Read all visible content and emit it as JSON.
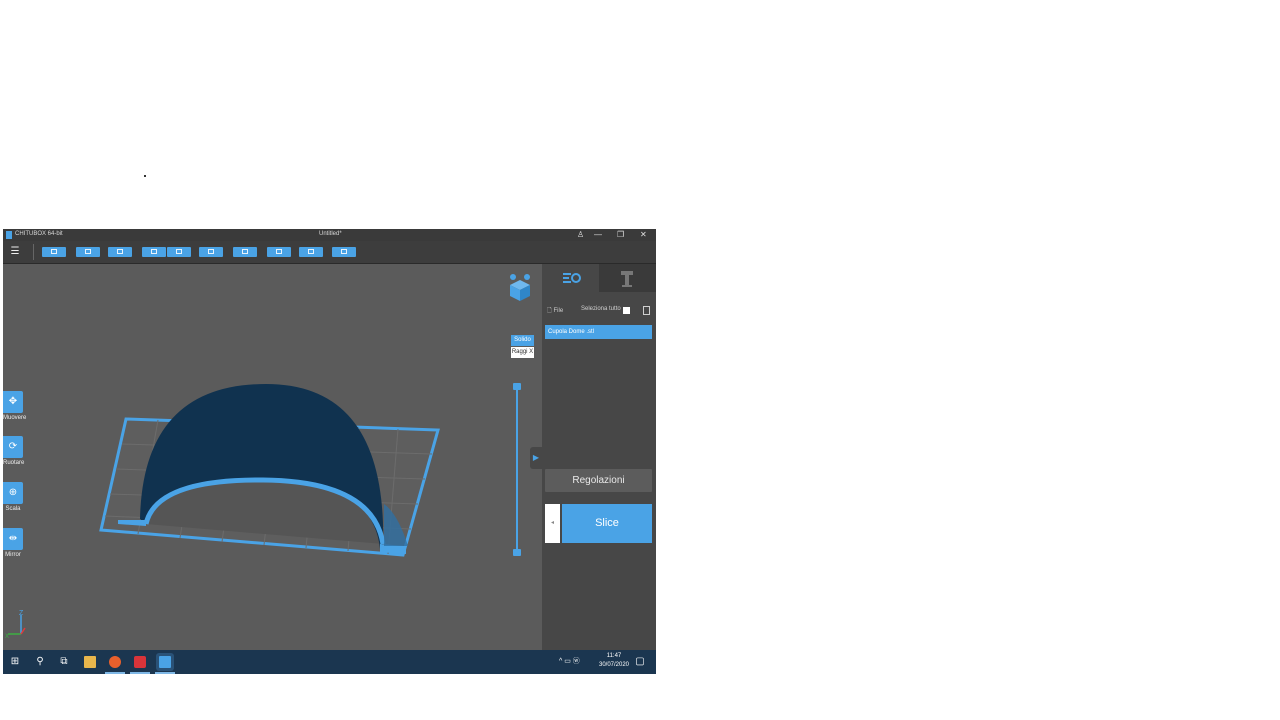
{
  "window": {
    "app_title": "CHITUBOX 64-bit",
    "doc_title": "Untitled*",
    "controls": {
      "user": "♙",
      "minimize": "—",
      "maximize": "❐",
      "close": "✕"
    }
  },
  "toolbar": {
    "menu_icon": "menu-icon",
    "buttons": [
      "open-file",
      "save-file",
      "screenshot",
      "copy",
      "paste",
      "rotate",
      "scale",
      "support",
      "layout",
      "hollow"
    ]
  },
  "left_tools": [
    {
      "label": "Muovere",
      "icon": "move-icon",
      "glyph": "✥"
    },
    {
      "label": "Ruotare",
      "icon": "rotate-icon",
      "glyph": "⟳"
    },
    {
      "label": "Scala",
      "icon": "scale-icon",
      "glyph": "⊕"
    },
    {
      "label": "Mirror",
      "icon": "mirror-icon",
      "glyph": "⇹"
    }
  ],
  "view_modes": {
    "solid": "Solido",
    "xray": "Raggi X"
  },
  "axes": {
    "z": "Z",
    "x": "X",
    "y": "Y"
  },
  "panel": {
    "file_label": "File",
    "select_all_label": "Seleziona tutto",
    "file_item": "Cupola Dome .stl",
    "settings_button": "Regolazioni",
    "slice_button": "Slice",
    "slice_side": "◂"
  },
  "taskbar": {
    "clock_time": "11:47",
    "clock_date": "30/07/2020",
    "tray_text": "^ ▭ ⓦ"
  },
  "colors": {
    "accent": "#4aa3e6",
    "dome": "#10324f",
    "viewport_bg": "#5b5b5b",
    "taskbar": "#1b3650"
  }
}
